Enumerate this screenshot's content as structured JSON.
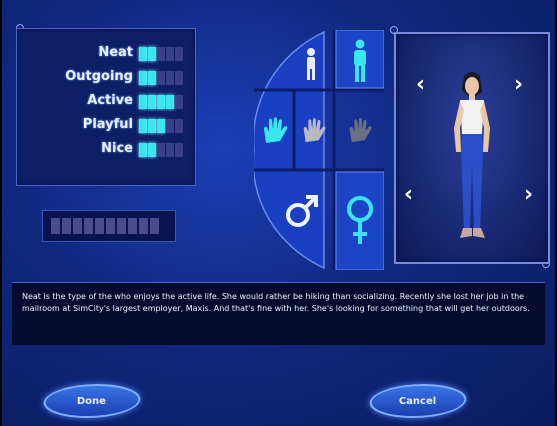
{
  "personality": {
    "traits": [
      {
        "label": "Neat",
        "level": 2,
        "max": 5
      },
      {
        "label": "Outgoing",
        "level": 2,
        "max": 5
      },
      {
        "label": "Active",
        "level": 4,
        "max": 5
      },
      {
        "label": "Playful",
        "level": 3,
        "max": 5
      },
      {
        "label": "Nice",
        "level": 2,
        "max": 5
      }
    ]
  },
  "name_field": {
    "value": ""
  },
  "selector_wheel": {
    "items": [
      {
        "name": "child-figure-icon",
        "selected": false
      },
      {
        "name": "adult-figure-icon",
        "selected": false
      },
      {
        "name": "light-skin-hand-icon",
        "selected": true
      },
      {
        "name": "medium-skin-hand-icon",
        "selected": false
      },
      {
        "name": "dark-skin-hand-icon",
        "selected": false
      },
      {
        "name": "male-symbol-icon",
        "selected": false
      },
      {
        "name": "female-symbol-icon",
        "selected": false
      }
    ]
  },
  "description": {
    "text": "Neat is the type of the who enjoys the active life. She would rather be hiking than socializing. Recently she lost her job in the mailroom at SimCity's largest employer, Maxis. And that's fine with her. She's looking for something that will get her outdoors."
  },
  "buttons": {
    "done_label": "Done",
    "cancel_label": "Cancel"
  },
  "colors": {
    "background": "#10297f",
    "bar_on": "#39e6f0",
    "bar_off": "#3a3f87",
    "button": "#1b45c6"
  }
}
